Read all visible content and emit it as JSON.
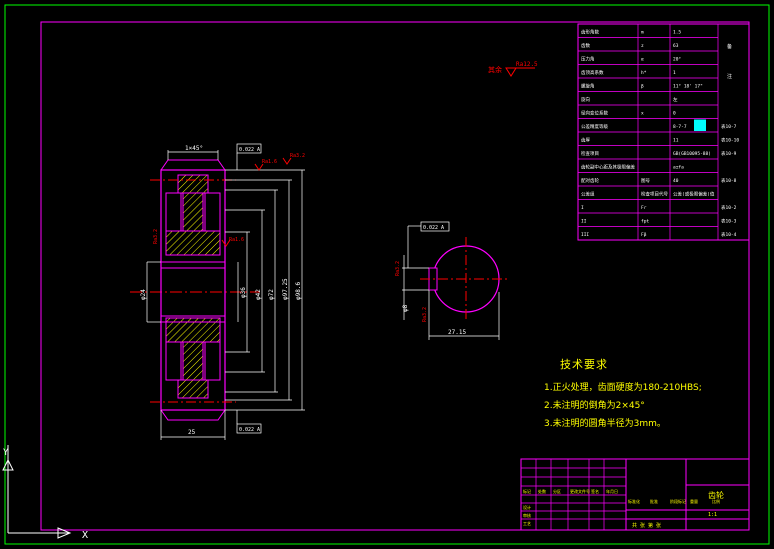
{
  "colors": {
    "background": "#000000",
    "frame": "#ff00ff",
    "outline": "#00ff00",
    "table_text": "#ffffff",
    "dimension": "#ffffff",
    "geometry": "#ff00ff",
    "annotation": "#ff0000",
    "hatch": "#ffff00",
    "center": "#ff0000",
    "highlight": "#00ffff",
    "note_text": "#ffff00"
  },
  "params_table": {
    "rows": [
      [
        "齿形角数",
        "m",
        "1.5",
        ""
      ],
      [
        "齿数",
        "z",
        "63",
        ""
      ],
      [
        "压力角",
        "α",
        "20°",
        ""
      ],
      [
        "齿顶高系数",
        "h*",
        "1",
        ""
      ],
      [
        "螺旋角",
        "β",
        "11° 18' 17\"",
        ""
      ],
      [
        "旋向",
        "",
        "左",
        ""
      ],
      [
        "径向变位系数",
        "x",
        "0",
        ""
      ],
      [
        "公差精度等级",
        "",
        "8-7-7",
        "表10-7"
      ],
      [
        "齿厚",
        "",
        "11",
        "表10-10"
      ],
      [
        "检查项目",
        "",
        "GB(GB10095-88)",
        "表10-9"
      ],
      [
        "齿轮副中心距及其极限偏差",
        "",
        "a±fa",
        ""
      ],
      [
        "配对齿轮",
        "图号",
        "40",
        "表10-8"
      ],
      [
        "公差组",
        "检查项目代号",
        "公差(或极限偏差)值",
        ""
      ],
      [
        "I",
        "Fr",
        "",
        "表10-2"
      ],
      [
        "II",
        "fpt",
        "",
        "表10-3"
      ],
      [
        "III",
        "Fβ",
        "",
        "表10-4"
      ]
    ],
    "side_labels": [
      "备",
      "注"
    ]
  },
  "dimensions": {
    "chamfer": "1×45°",
    "width": "25",
    "bore": "φ24",
    "diam_a": "φ36",
    "diam_b": "φ42",
    "diam_c": "φ72",
    "diam_d": "φ97.25",
    "diam_e": "φ98.6",
    "key_depth": "27.15",
    "key_width": "φ8",
    "tol_radial": "0.022 A",
    "tol_face": "0.022 A",
    "rough_1": "Ra1.6",
    "rough_2": "Ra3.2",
    "rough_3": "Ra1.6",
    "rough_4": "Ra3.2",
    "rough_key": "Ra3.2",
    "rough_general": "Ra12.5",
    "rough_general_prefix": "其余"
  },
  "tech_requirements": {
    "title": "技术要求",
    "items": [
      "1.正火处理，齿面硬度为180-210HBS;",
      "2.未注明的倒角为2×45°",
      "3.未注明的圆角半径为3mm。"
    ]
  },
  "title_block": {
    "part_name": "齿轮",
    "labels": [
      "标记",
      "处数",
      "分区",
      "更改文件号",
      "签名",
      "年月日"
    ],
    "row_labels": [
      "设计",
      "审核",
      "工艺"
    ],
    "col_labels": [
      "标准化",
      "批准",
      "阶段标记",
      "重量",
      "比例"
    ],
    "scale": "1:1",
    "sheet": "共 张 第 张"
  }
}
